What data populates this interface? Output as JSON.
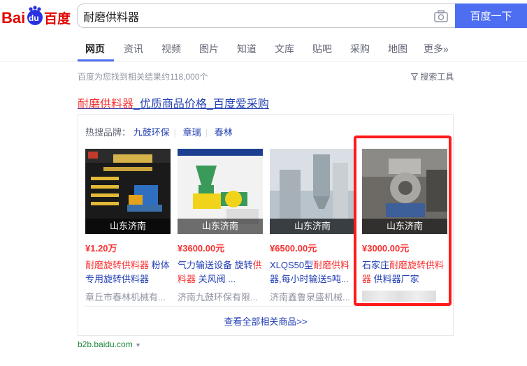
{
  "logo": {
    "text_bai": "Bai",
    "text_du": "du",
    "text_cn": "百度",
    "color_red": "#e10601",
    "color_blue": "#2932e1"
  },
  "search": {
    "query": "耐磨供料器",
    "button_label": "百度一下",
    "camera_icon": "camera-icon"
  },
  "tabs": [
    {
      "label": "网页",
      "active": true
    },
    {
      "label": "资讯"
    },
    {
      "label": "视频"
    },
    {
      "label": "图片"
    },
    {
      "label": "知道"
    },
    {
      "label": "文库"
    },
    {
      "label": "贴吧"
    },
    {
      "label": "采购"
    },
    {
      "label": "地图"
    },
    {
      "label": "更多»"
    }
  ],
  "results": {
    "count_text": "百度为您找到相关结果约118,000个",
    "tools_label": "搜索工具"
  },
  "ad": {
    "title_highlight": "耐磨供料器",
    "title_rest": "_优质商品价格_百度爱采购",
    "brands_label": "热搜品牌：",
    "brands": [
      "九鼓环保",
      "章瑞",
      "春林"
    ],
    "products": [
      {
        "location": "山东济南",
        "price": "¥1.20万",
        "name_hl": "耐磨旋转供料器",
        "name_rest": " 粉体专用旋转供料器",
        "shop": "章丘市春林机械有..."
      },
      {
        "location": "山东济南",
        "price": "¥3600.00元",
        "name_pre": "气力输送设备 旋转",
        "name_hl": "供料器",
        "name_rest": " 关风阀 ...",
        "shop": "济南九鼓环保有限..."
      },
      {
        "location": "山东济南",
        "price": "¥6500.00元",
        "name_pre": "XLQS50型",
        "name_hl": "耐磨供料",
        "name_rest": "器,每小时输送5吨...",
        "shop": "济南鑫鲁泉盛机械..."
      },
      {
        "location": "山东济南",
        "price": "¥3000.00元",
        "name_pre": "石家庄",
        "name_hl": "耐磨旋转供料器",
        "name_rest": " 供料器厂家",
        "shop": ""
      }
    ],
    "view_all": "查看全部相关商品>>"
  },
  "source": {
    "domain": "b2b.baidu.com"
  },
  "accent": {
    "link": "#2440b3",
    "highlight": "#f73131",
    "button": "#4e6ef2",
    "frame": "#ff1a1a"
  }
}
